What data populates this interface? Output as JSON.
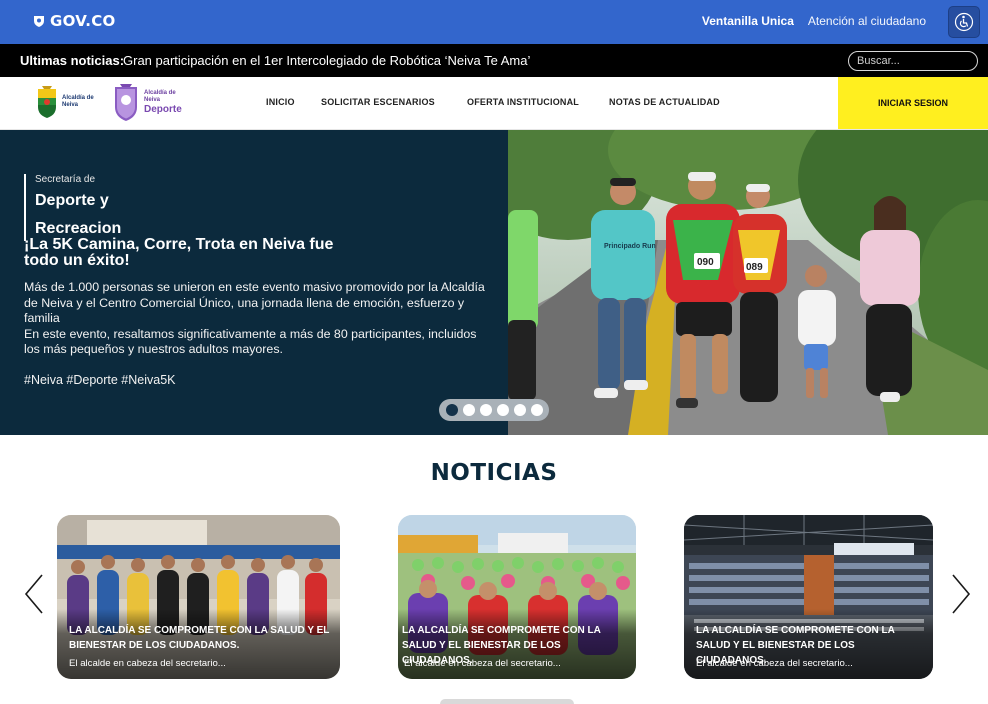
{
  "gov_bar": {
    "logo_text": "GOV.CO",
    "links": [
      "Ventanilla Unica",
      "Atención al ciudadano"
    ],
    "accessibility_icon": "accessibility-icon",
    "color": "#3366cc"
  },
  "ticker": {
    "label": "Ultimas noticias:",
    "headline": "Gran participación en el 1er Intercolegiado de Robótica ‘Neiva Te Ama’",
    "search_placeholder": "Buscar..."
  },
  "nav": {
    "logo1_text": "Alcaldía de Neiva",
    "logo2_small": "Alcaldía de Neiva",
    "logo2_big": "Deporte",
    "items": [
      "INICIO",
      "SOLICITAR ESCENARIOS",
      "OFERTA INSTITUCIONAL",
      "NOTAS DE ACTUALIDAD"
    ],
    "login": "INICIAR SESION",
    "login_color": "#ffef1f"
  },
  "hero": {
    "sec_small": "Secretaría de",
    "sec_big_1": "Deporte y",
    "sec_big_2": "Recreacion",
    "title": "¡La 5K Camina, Corre, Trota en Neiva fue todo un éxito!",
    "body_1": "Más de 1.000 personas se unieron en este evento masivo promovido por la Alcaldía de Neiva y el Centro Comercial Único, una jornada llena de emoción, esfuerzo y familia",
    "body_2": "En este evento, resaltamos significativamente a más de 80 participantes, incluidos los más pequeños y nuestros adultos mayores.",
    "tags": "#Neiva #Deporte #Neiva5K",
    "bib_1": "090",
    "bib_2": "089",
    "shirt_text": "Principado Run",
    "slides_total": 6,
    "active_slide": 1,
    "bg_color": "#0c2a3d"
  },
  "news": {
    "title": "NOTICIAS",
    "prev_icon": "chevron-left-icon",
    "next_icon": "chevron-right-icon",
    "cards": [
      {
        "title": "LA ALCALDÍA SE COMPROMETE CON LA SALUD Y EL BIENESTAR DE LOS CIUDADANOS.",
        "excerpt": "El alcalde en cabeza del secretario..."
      },
      {
        "title": "LA ALCALDÍA SE COMPROMETE CON LA SALUD Y EL BIENESTAR DE LOS CIUDADANOS.",
        "excerpt": "El alcalde en cabeza del secretario..."
      },
      {
        "title": "LA ALCALDÍA SE COMPROMETE CON LA SALUD Y EL BIENESTAR DE LOS CIUDADANOS.",
        "excerpt": "El alcalde en cabeza del secretario..."
      }
    ]
  }
}
